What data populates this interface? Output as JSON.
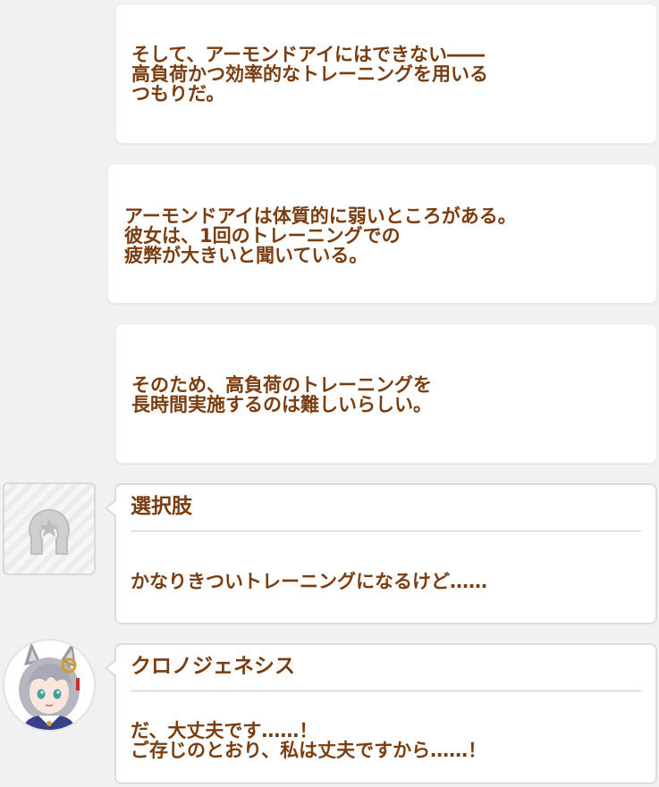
{
  "colors": {
    "background": "#f1f1f1",
    "bubble": "#ffffff",
    "text": "#7a3d10",
    "divider": "#c9c9c9"
  },
  "narration": [
    {
      "lines": [
        "そして、アーモンドアイにはできない――",
        "高負荷かつ効率的なトレーニングを用いる",
        "つもりだ。"
      ]
    },
    {
      "lines": [
        "アーモンドアイは体質的に弱いところがある。",
        "彼女は、1回のトレーニングでの",
        "疲弊が大きいと聞いている。"
      ]
    },
    {
      "lines": [
        "そのため、高負荷のトレーニングを",
        "長時間実施するのは難しいらしい。"
      ]
    }
  ],
  "choice": {
    "speaker": "選択肢",
    "icon": "horseshoe-star-icon",
    "lines": [
      "かなりきついトレーニングになるけど……"
    ]
  },
  "dialogue": {
    "speaker": "クロノジェネシス",
    "avatar": "character-portrait",
    "lines": [
      "だ、大丈夫です……！",
      "ご存じのとおり、私は丈夫ですから……！"
    ]
  }
}
